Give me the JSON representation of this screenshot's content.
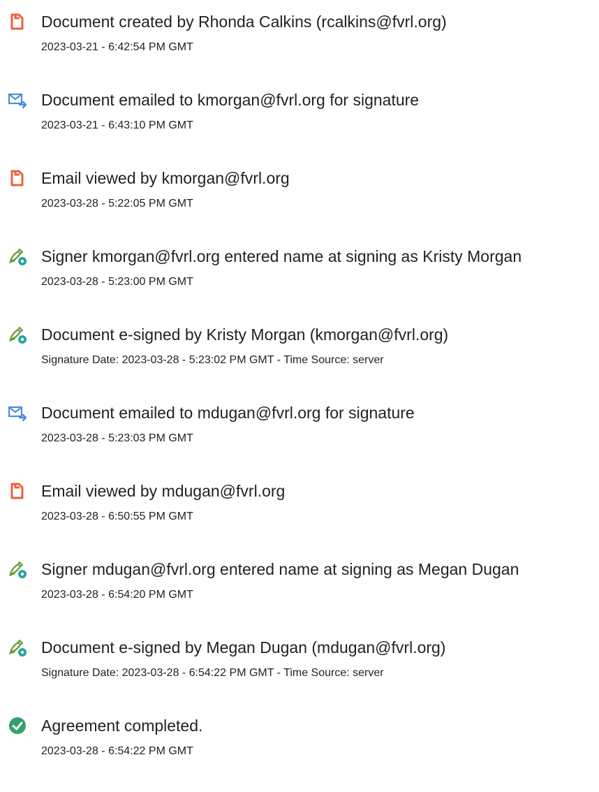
{
  "audit_events": [
    {
      "icon": "document-created-icon",
      "title": "Document created by Rhonda Calkins (rcalkins@fvrl.org)",
      "timestamp": "2023-03-21 - 6:42:54 PM GMT"
    },
    {
      "icon": "email-sent-icon",
      "title": "Document emailed to kmorgan@fvrl.org for signature",
      "timestamp": "2023-03-21 - 6:43:10 PM GMT"
    },
    {
      "icon": "document-viewed-icon",
      "title": "Email viewed by kmorgan@fvrl.org",
      "timestamp": "2023-03-28 - 5:22:05 PM GMT"
    },
    {
      "icon": "esign-icon",
      "title": "Signer kmorgan@fvrl.org entered name at signing as Kristy Morgan",
      "timestamp": "2023-03-28 - 5:23:00 PM GMT"
    },
    {
      "icon": "esign-icon",
      "title": "Document e-signed by Kristy Morgan (kmorgan@fvrl.org)",
      "timestamp": "Signature Date: 2023-03-28 - 5:23:02 PM GMT - Time Source: server"
    },
    {
      "icon": "email-sent-icon",
      "title": "Document emailed to mdugan@fvrl.org for signature",
      "timestamp": "2023-03-28 - 5:23:03 PM GMT"
    },
    {
      "icon": "document-viewed-icon",
      "title": "Email viewed by mdugan@fvrl.org",
      "timestamp": "2023-03-28 - 6:50:55 PM GMT"
    },
    {
      "icon": "esign-icon",
      "title": "Signer mdugan@fvrl.org entered name at signing as Megan Dugan",
      "timestamp": "2023-03-28 - 6:54:20 PM GMT"
    },
    {
      "icon": "esign-icon",
      "title": "Document e-signed by Megan Dugan (mdugan@fvrl.org)",
      "timestamp": "Signature Date: 2023-03-28 - 6:54:22 PM GMT - Time Source: server"
    },
    {
      "icon": "check-circle-icon",
      "title": "Agreement completed.",
      "timestamp": "2023-03-28 - 6:54:22 PM GMT"
    }
  ],
  "colors": {
    "document_icon": "#e8633a",
    "email_icon": "#4a8fd8",
    "esign_pen": "#6a9a3a",
    "esign_badge": "#2aa3a0",
    "check_circle": "#35a06a",
    "text": "#222222"
  }
}
